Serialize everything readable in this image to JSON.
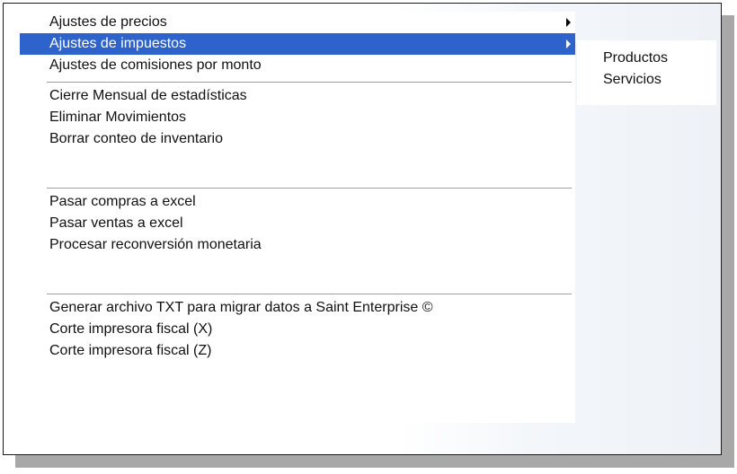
{
  "menu": {
    "items": [
      {
        "label": "Ajustes de precios",
        "has_submenu": true
      },
      {
        "label": "Ajustes de impuestos",
        "has_submenu": true,
        "highlighted": true
      },
      {
        "label": "Ajustes de comisiones por monto"
      },
      {
        "label": "Cierre Mensual de estadísticas"
      },
      {
        "label": "Eliminar Movimientos"
      },
      {
        "label": "Borrar conteo de inventario"
      },
      {
        "label": "Pasar compras a excel"
      },
      {
        "label": "Pasar ventas a excel"
      },
      {
        "label": "Procesar reconversión monetaria"
      },
      {
        "label": "Generar archivo TXT para migrar datos a Saint Enterprise ©"
      },
      {
        "label": "Corte impresora fiscal (X)"
      },
      {
        "label": "Corte impresora fiscal (Z)"
      }
    ]
  },
  "submenu": {
    "items": [
      {
        "label": "Productos"
      },
      {
        "label": "Servicios"
      }
    ]
  },
  "colors": {
    "highlight": "#2f63cc",
    "highlight_text": "#ffffff",
    "text": "#111111"
  },
  "icons": {
    "submenu_arrow": "triangle-right"
  }
}
